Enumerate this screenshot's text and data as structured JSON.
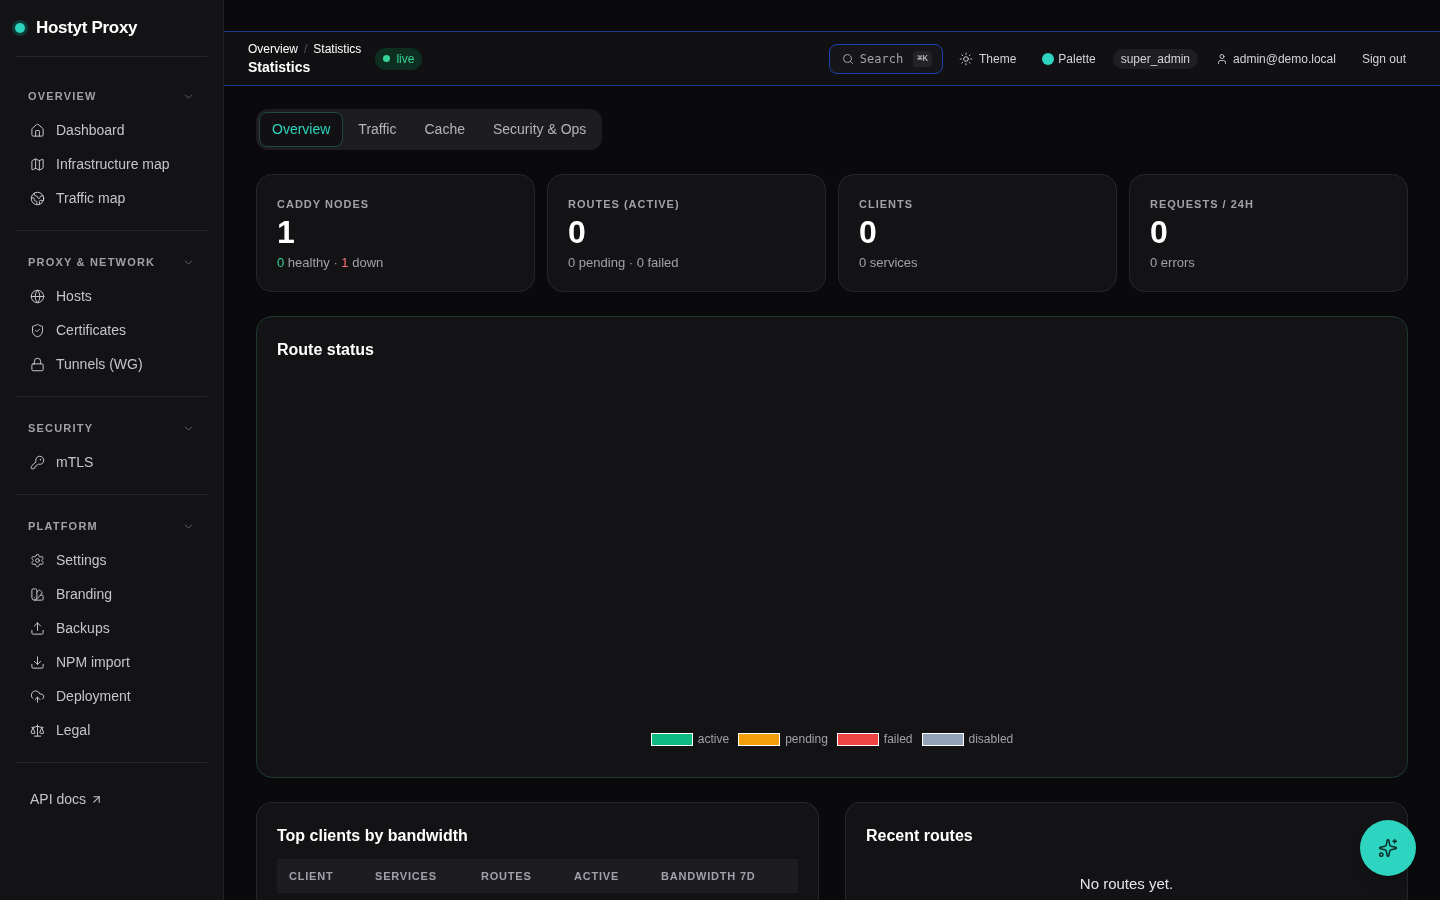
{
  "sidebar": {
    "brand": "Hostyt Proxy",
    "sections": [
      {
        "title": "OVERVIEW",
        "expanded": true,
        "items": [
          {
            "label": "Dashboard",
            "selected": false
          },
          {
            "label": "Infrastructure map",
            "selected": false
          },
          {
            "label": "Traffic map",
            "selected": false
          }
        ]
      },
      {
        "title": "PROXY & NETWORK",
        "expanded": true,
        "items": [
          {
            "label": "Hosts",
            "selected": false
          },
          {
            "label": "Certificates",
            "selected": false
          },
          {
            "label": "Tunnels (WG)",
            "selected": false
          }
        ]
      },
      {
        "title": "SECURITY",
        "expanded": true,
        "items": [
          {
            "label": "mTLS",
            "selected": false
          }
        ]
      },
      {
        "title": "PLATFORM",
        "expanded": true,
        "items": [
          {
            "label": "Settings",
            "selected": false
          },
          {
            "label": "Branding",
            "selected": false
          },
          {
            "label": "Backups",
            "selected": false
          },
          {
            "label": "NPM import",
            "selected": false
          },
          {
            "label": "Deployment",
            "selected": false
          },
          {
            "label": "Legal",
            "selected": false
          }
        ]
      }
    ],
    "footer_link": "API docs"
  },
  "header": {
    "breadcrumb": [
      "Overview",
      "/",
      "Statistics"
    ],
    "title": "Statistics",
    "status_badge": "live",
    "search": {
      "label": "Search",
      "shortcut": "⌘K"
    },
    "theme": "Theme",
    "palette": "Palette",
    "role": "super_admin",
    "user": "admin@demo.local",
    "sign_out": "Sign out"
  },
  "tabs": [
    {
      "label": "Overview",
      "selected": true
    },
    {
      "label": "Traffic",
      "selected": false
    },
    {
      "label": "Cache",
      "selected": false
    },
    {
      "label": "Security & Ops",
      "selected": false
    }
  ],
  "stats": [
    {
      "label": "CADDY NODES",
      "value": "1",
      "detail": [
        {
          "text": "0",
          "color": "#34d399"
        },
        {
          "text": " healthy · "
        },
        {
          "text": "1",
          "color": "#f87171"
        },
        {
          "text": " down"
        }
      ]
    },
    {
      "label": "ROUTES (ACTIVE)",
      "value": "0",
      "detail": [
        {
          "text": "0 pending · 0 failed"
        }
      ]
    },
    {
      "label": "CLIENTS",
      "value": "0",
      "detail": [
        {
          "text": "0 services"
        }
      ]
    },
    {
      "label": "REQUESTS / 24H",
      "value": "0",
      "detail": [
        {
          "text": "0 errors"
        }
      ]
    }
  ],
  "route_status": {
    "title": "Route status",
    "legend": [
      {
        "label": "active",
        "color": "#10b981"
      },
      {
        "label": "pending",
        "color": "#f59e0b"
      },
      {
        "label": "failed",
        "color": "#ef4444"
      },
      {
        "label": "disabled",
        "color": "#94a3b8"
      }
    ]
  },
  "top_clients": {
    "title": "Top clients by bandwidth",
    "columns": [
      "CLIENT",
      "SERVICES",
      "ROUTES",
      "ACTIVE",
      "BANDWIDTH 7D"
    ]
  },
  "recent_routes": {
    "title": "Recent routes",
    "empty_message": "No routes yet."
  }
}
